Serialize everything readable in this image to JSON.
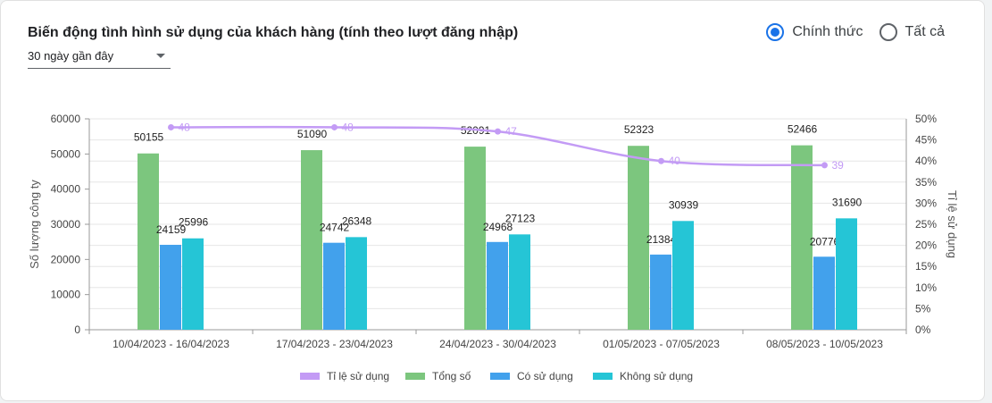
{
  "header": {
    "title": "Biến động tình hình sử dụng của khách hàng (tính theo lượt đăng nhập)",
    "period_select": "30 ngày gần đây"
  },
  "filters": [
    {
      "label": "Chính thức",
      "checked": true
    },
    {
      "label": "Tất cả",
      "checked": false
    }
  ],
  "colors": {
    "rate": "#c39bf5",
    "total": "#7cc67e",
    "used": "#42a1ec",
    "unused": "#25c5d6"
  },
  "chart_data": {
    "type": "bar",
    "categories": [
      "10/04/2023 - 16/04/2023",
      "17/04/2023 - 23/04/2023",
      "24/04/2023 - 30/04/2023",
      "01/05/2023 - 07/05/2023",
      "08/05/2023 - 10/05/2023"
    ],
    "series": [
      {
        "name": "Tổng số",
        "type": "bar",
        "axis": "left",
        "values": [
          50155,
          51090,
          52091,
          52323,
          52466
        ]
      },
      {
        "name": "Có sử dụng",
        "type": "bar",
        "axis": "left",
        "values": [
          24159,
          24742,
          24968,
          21384,
          20776
        ]
      },
      {
        "name": "Không sử dụng",
        "type": "bar",
        "axis": "left",
        "values": [
          25996,
          26348,
          27123,
          30939,
          31690
        ]
      },
      {
        "name": "Tỉ lệ sử dụng",
        "type": "line",
        "axis": "right",
        "values": [
          48,
          48,
          47,
          40,
          39
        ]
      }
    ],
    "legend_order": [
      "Tỉ lệ sử dụng",
      "Tổng số",
      "Có sử dụng",
      "Không sử dụng"
    ],
    "ylabel": "Số lượng công ty",
    "y2label": "Tỉ lệ sử dụng",
    "ylim": [
      0,
      60000
    ],
    "yticks": [
      "0",
      "10000",
      "20000",
      "30000",
      "40000",
      "50000",
      "60000"
    ],
    "y2lim": [
      0,
      50
    ],
    "y2ticks": [
      "0%",
      "5%",
      "10%",
      "15%",
      "20%",
      "25%",
      "30%",
      "35%",
      "40%",
      "45%",
      "50%"
    ],
    "grid": true,
    "legend_position": "bottom"
  }
}
